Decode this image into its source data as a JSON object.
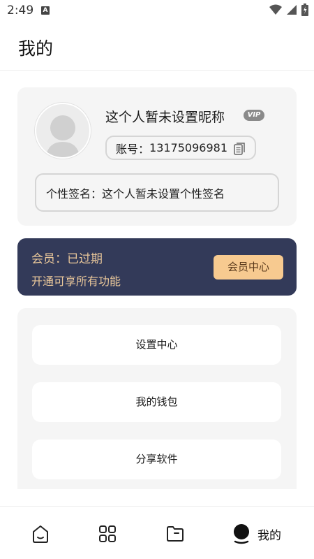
{
  "status_bar": {
    "time": "2:49",
    "notification_badge": "A"
  },
  "header": {
    "title": "我的"
  },
  "profile": {
    "nickname": "这个人暂未设置昵称",
    "vip_badge": "VIP",
    "account_label": "账号：",
    "account_value": "13175096981",
    "signature_label": "个性签名：",
    "signature_value": "这个人暂未设置个性签名"
  },
  "membership": {
    "status": "会员：已过期",
    "description": "开通可享所有功能",
    "button_label": "会员中心",
    "colors": {
      "card_bg": "#333a59",
      "text": "#e9c79a",
      "button_bg": "#f7ca90"
    }
  },
  "menu": {
    "items": [
      {
        "label": "设置中心"
      },
      {
        "label": "我的钱包"
      },
      {
        "label": "分享软件"
      }
    ]
  },
  "bottom_nav": {
    "tabs": [
      {
        "icon": "home-icon",
        "label": ""
      },
      {
        "icon": "apps-grid-icon",
        "label": ""
      },
      {
        "icon": "folder-icon",
        "label": ""
      },
      {
        "icon": "profile-icon",
        "label": "我的",
        "active": true
      }
    ]
  }
}
